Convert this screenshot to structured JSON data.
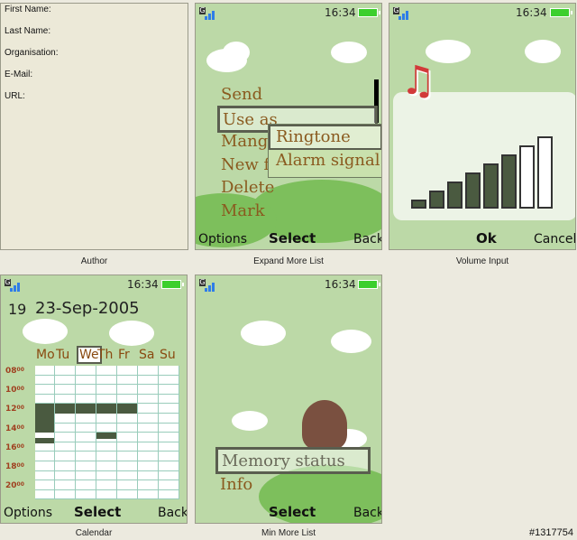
{
  "watermark": "#1317754",
  "author": {
    "caption": "Author",
    "fields": [
      "First Name:",
      "Last Name:",
      "Organisation:",
      "E-Mail:",
      "URL:"
    ]
  },
  "expand": {
    "caption": "Expand More List",
    "time": "16:34",
    "menu": [
      "Send",
      "Use as",
      "Mang",
      "New f",
      "Delete",
      "Mark"
    ],
    "submenu": [
      "Ringtone",
      "Alarm signal"
    ],
    "softkeys": {
      "left": "Options",
      "center": "Select",
      "right": "Back"
    }
  },
  "volume": {
    "caption": "Volume Input",
    "time": "16:34",
    "level_of_8": 6,
    "music_icon": "music-note-icon",
    "softkeys": {
      "center": "Ok",
      "right": "Cancel"
    }
  },
  "calendar": {
    "caption": "Calendar",
    "time": "16:34",
    "week_number": "19",
    "date": "23-Sep-2005",
    "weekdays": [
      "Mo",
      "Tu",
      "We",
      "Th",
      "Fr",
      "Sa",
      "Su"
    ],
    "selected_weekday": "We",
    "hours": [
      "08",
      "10",
      "12",
      "14",
      "16",
      "18",
      "20"
    ],
    "minutes": "00",
    "softkeys": {
      "left": "Options",
      "center": "Select",
      "right": "Back"
    }
  },
  "minmore": {
    "caption": "Min More List",
    "time": "16:34",
    "menu": [
      "Memory status",
      "Info"
    ],
    "softkeys": {
      "center": "Select",
      "right": "Back"
    }
  },
  "colors": {
    "screen_bg": "#bcd9a7",
    "menu_text": "#8a5a1f",
    "highlight_border": "#5a5e4f",
    "battery": "#3ccf2e"
  }
}
